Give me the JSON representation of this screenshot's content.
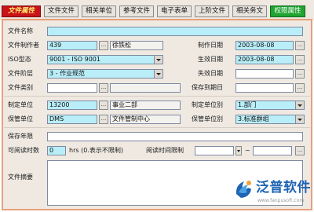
{
  "toolbar": {
    "tabs": [
      "文件属性",
      "文件文件",
      "相关单位",
      "参考文件",
      "电子表单",
      "上阶文件",
      "相关务文",
      "权限属性"
    ]
  },
  "form": {
    "file_name_label": "文件名称",
    "file_name_value": "",
    "author_label": "文件制作者",
    "author_code": "439",
    "author_name": "徐铁松",
    "made_date_label": "制作日期",
    "made_date_value": "2003-08-08",
    "iso_label": "ISO型态",
    "iso_value": "9001 - ISO 9001",
    "effective_date_label": "生效日期",
    "effective_date_value": "2003-08-08",
    "level_label": "文件阶层",
    "level_value": "3 - 作业规范",
    "invalid_date_label": "失效日期",
    "invalid_date_value": "",
    "category_label": "文件类别",
    "category_code": "",
    "category_name": "",
    "retention_expire_label": "保存到期日",
    "retention_expire_value": "",
    "make_unit_label": "制定单位",
    "make_unit_code": "13200",
    "make_unit_name": "事业二部",
    "make_unit_level_label": "制定单位别",
    "make_unit_level_value": "1.部门",
    "keep_unit_label": "保管单位",
    "keep_unit_code": "DMS",
    "keep_unit_name": "文件管制中心",
    "keep_unit_level_label": "保管单位别",
    "keep_unit_level_value": "3.标准群组",
    "retention_years_label": "保存年限",
    "retention_years_value": "",
    "readable_times_label": "可阅读时数",
    "readable_times_value": "0",
    "hours_hint": "hrs (0.表示不限制)",
    "read_limit_label": "阅读时间限制",
    "read_limit_from": "",
    "read_limit_tilde": "~",
    "read_limit_to": "",
    "summary_label": "文件摘要",
    "summary_value": ""
  },
  "icons": {
    "lookup_button_glyph": "...",
    "logo_mark": "fanpu-logo-icon"
  },
  "branding": {
    "name": "泛普软件",
    "url": "www.fanpusoft.com",
    "color": "#1e63b4"
  }
}
